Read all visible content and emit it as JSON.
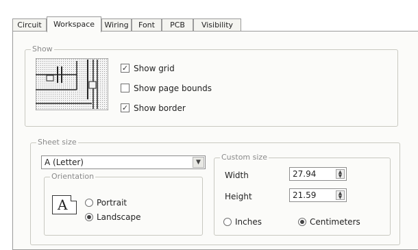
{
  "tabs": [
    {
      "label": "Circuit",
      "active": false
    },
    {
      "label": "Workspace",
      "active": true
    },
    {
      "label": "Wiring",
      "active": false
    },
    {
      "label": "Font",
      "active": false
    },
    {
      "label": "PCB",
      "active": false
    },
    {
      "label": "Visibility",
      "active": false
    }
  ],
  "show_group": {
    "legend": "Show",
    "preview_icon": "grid-preview-icon",
    "show_grid": {
      "label": "Show grid",
      "checked": true
    },
    "show_page_bounds": {
      "label": "Show page bounds",
      "checked": false
    },
    "show_border": {
      "label": "Show border",
      "checked": true
    },
    "check_glyph": "✓"
  },
  "sheet_size": {
    "legend": "Sheet size",
    "selected": "A (Letter)",
    "dropdown_icon": "chevron-down-icon",
    "orientation": {
      "legend": "Orientation",
      "page_icon_letter": "A",
      "portrait": {
        "label": "Portrait",
        "selected": false
      },
      "landscape": {
        "label": "Landscape",
        "selected": true
      }
    },
    "custom_size": {
      "legend": "Custom size",
      "width_label": "Width",
      "width_value": "27.94",
      "height_label": "Height",
      "height_value": "21.59",
      "inches": {
        "label": "Inches",
        "selected": false
      },
      "centimeters": {
        "label": "Centimeters",
        "selected": true
      }
    }
  }
}
